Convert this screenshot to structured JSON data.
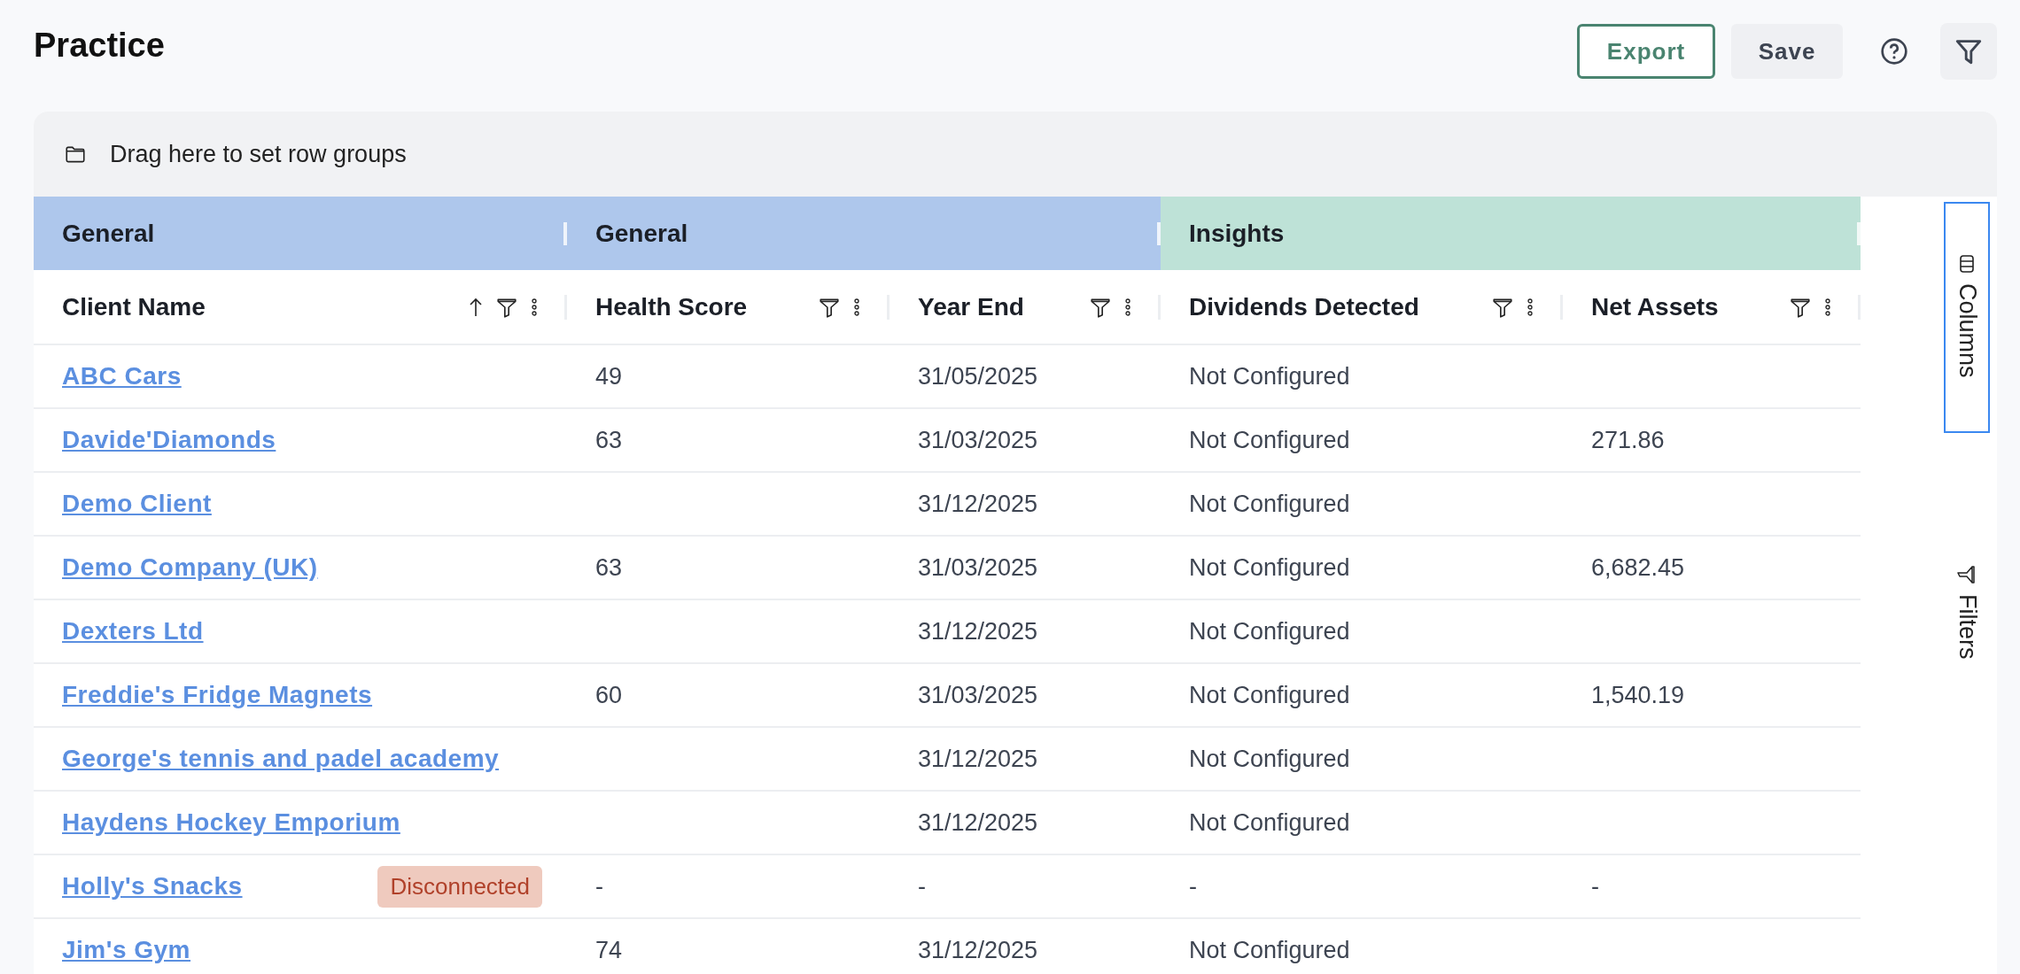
{
  "page": {
    "title": "Practice"
  },
  "toolbar": {
    "buttons": [
      {
        "label": "Export",
        "kind": "outline"
      },
      {
        "label": "Save",
        "kind": "plain"
      }
    ]
  },
  "row_group_panel": {
    "text": "Drag here to set row groups"
  },
  "table": {
    "column_groups": [
      {
        "label": "General",
        "kind": "general"
      },
      {
        "label": "General",
        "kind": "general"
      },
      {
        "label": "Insights",
        "kind": "insights"
      }
    ],
    "columns": [
      {
        "label": "Client Name",
        "sorted": true
      },
      {
        "label": "Health Score",
        "sorted": false
      },
      {
        "label": "Year End",
        "sorted": false
      },
      {
        "label": "Dividends Detected",
        "sorted": false
      },
      {
        "label": "Net Assets",
        "sorted": false
      }
    ],
    "rows": [
      {
        "client": "ABC Cars",
        "health_score": "49",
        "year_end": "31/05/2025",
        "dividends": "Not Configured"
      },
      {
        "client": "Davide'Diamonds",
        "health_score": "63",
        "year_end": "31/03/2025",
        "dividends": "Not Configured",
        "net_assets": "271.86"
      },
      {
        "client": "Demo Client",
        "year_end": "31/12/2025",
        "dividends": "Not Configured"
      },
      {
        "client": "Demo Company (UK)",
        "health_score": "63",
        "year_end": "31/03/2025",
        "dividends": "Not Configured",
        "net_assets": "6,682.45"
      },
      {
        "client": "Dexters Ltd",
        "year_end": "31/12/2025",
        "dividends": "Not Configured"
      },
      {
        "client": "Freddie's Fridge Magnets",
        "health_score": "60",
        "year_end": "31/03/2025",
        "dividends": "Not Configured",
        "net_assets": "1,540.19"
      },
      {
        "client": "George's tennis and padel academy",
        "year_end": "31/12/2025",
        "dividends": "Not Configured"
      },
      {
        "client": "Haydens Hockey Emporium",
        "year_end": "31/12/2025",
        "dividends": "Not Configured"
      },
      {
        "client": "Holly's Snacks",
        "status": "Disconnected",
        "health_score": "-",
        "year_end": "-",
        "dividends": "-",
        "net_assets": "-"
      },
      {
        "client": "Jim's Gym",
        "health_score": "74",
        "year_end": "31/12/2025",
        "dividends": "Not Configured"
      }
    ]
  },
  "side_bar": {
    "tabs": [
      {
        "label": "Columns",
        "kind": "columns",
        "selected": true
      },
      {
        "label": "Filters",
        "kind": "filters",
        "selected": false
      }
    ]
  }
}
